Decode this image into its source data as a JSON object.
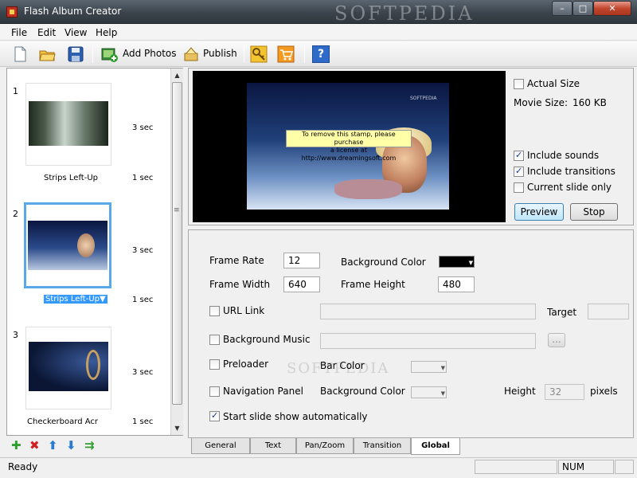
{
  "window": {
    "title": "Flash Album Creator",
    "controls": {
      "minimize": "–",
      "maximize": "□",
      "close": "✕"
    }
  },
  "watermark": {
    "text": "SOFTPEDIA"
  },
  "menu": [
    "File",
    "Edit",
    "View",
    "Help"
  ],
  "toolbar": {
    "add_photos": "Add Photos",
    "publish": "Publish",
    "icons": [
      "new-file-icon",
      "open-folder-icon",
      "save-icon",
      "add-photos-icon",
      "publish-icon",
      "key-icon",
      "cart-icon",
      "help-icon"
    ],
    "help_glyph": "?"
  },
  "slides": [
    {
      "number": "1",
      "duration": "3 sec",
      "transition": "Strips Left-Up",
      "transition_duration": "1 sec"
    },
    {
      "number": "2",
      "duration": "3 sec",
      "transition": "Strips Left-Up",
      "transition_duration": "1 sec"
    },
    {
      "number": "3",
      "duration": "3 sec",
      "transition": "Checkerboard Acr",
      "transition_duration": "1 sec"
    }
  ],
  "slide_actions": [
    "add-icon",
    "delete-icon",
    "move-up-icon",
    "move-down-icon",
    "shuffle-icon"
  ],
  "slide_action_glyphs": [
    "✚",
    "✖",
    "⬆",
    "⬇",
    "⇉"
  ],
  "preview": {
    "stamp_line1": "To remove this stamp, please purchase",
    "stamp_line2": "a license at http://www.dreamingsoft.com",
    "logo": "SOFTPEDIA"
  },
  "preview_options": {
    "actual_size": {
      "label": "Actual Size",
      "checked": false
    },
    "movie_size_label": "Movie Size:",
    "movie_size_value": "160 KB",
    "include_sounds": {
      "label": "Include sounds",
      "checked": true
    },
    "include_transitions": {
      "label": "Include transitions",
      "checked": true
    },
    "current_slide_only": {
      "label": "Current slide only",
      "checked": false
    },
    "preview_button": "Preview",
    "stop_button": "Stop"
  },
  "settings": {
    "frame_rate_label": "Frame Rate",
    "frame_rate": "12",
    "background_color_label": "Background Color",
    "background_color": "#000000",
    "frame_width_label": "Frame Width",
    "frame_width": "640",
    "frame_height_label": "Frame Height",
    "frame_height": "480",
    "url_link_label": "URL Link",
    "target_label": "Target",
    "background_music_label": "Background Music",
    "browse_label": "...",
    "preloader_label": "Preloader",
    "bar_color_label": "Bar Color",
    "navigation_panel_label": "Navigation Panel",
    "nav_background_color_label": "Background Color",
    "height_label": "Height",
    "height_value": "32",
    "pixels_label": "pixels",
    "start_auto_label": "Start slide show automatically",
    "start_auto_checked": true
  },
  "tabs": [
    "General",
    "Text",
    "Pan/Zoom",
    "Transition",
    "Global"
  ],
  "active_tab": "Global",
  "statusbar": {
    "status": "Ready",
    "num": "NUM"
  },
  "colors": {
    "selection": "#3399ff",
    "thumb_border": "#5aa8e8",
    "titlebar": "#3b444c"
  }
}
